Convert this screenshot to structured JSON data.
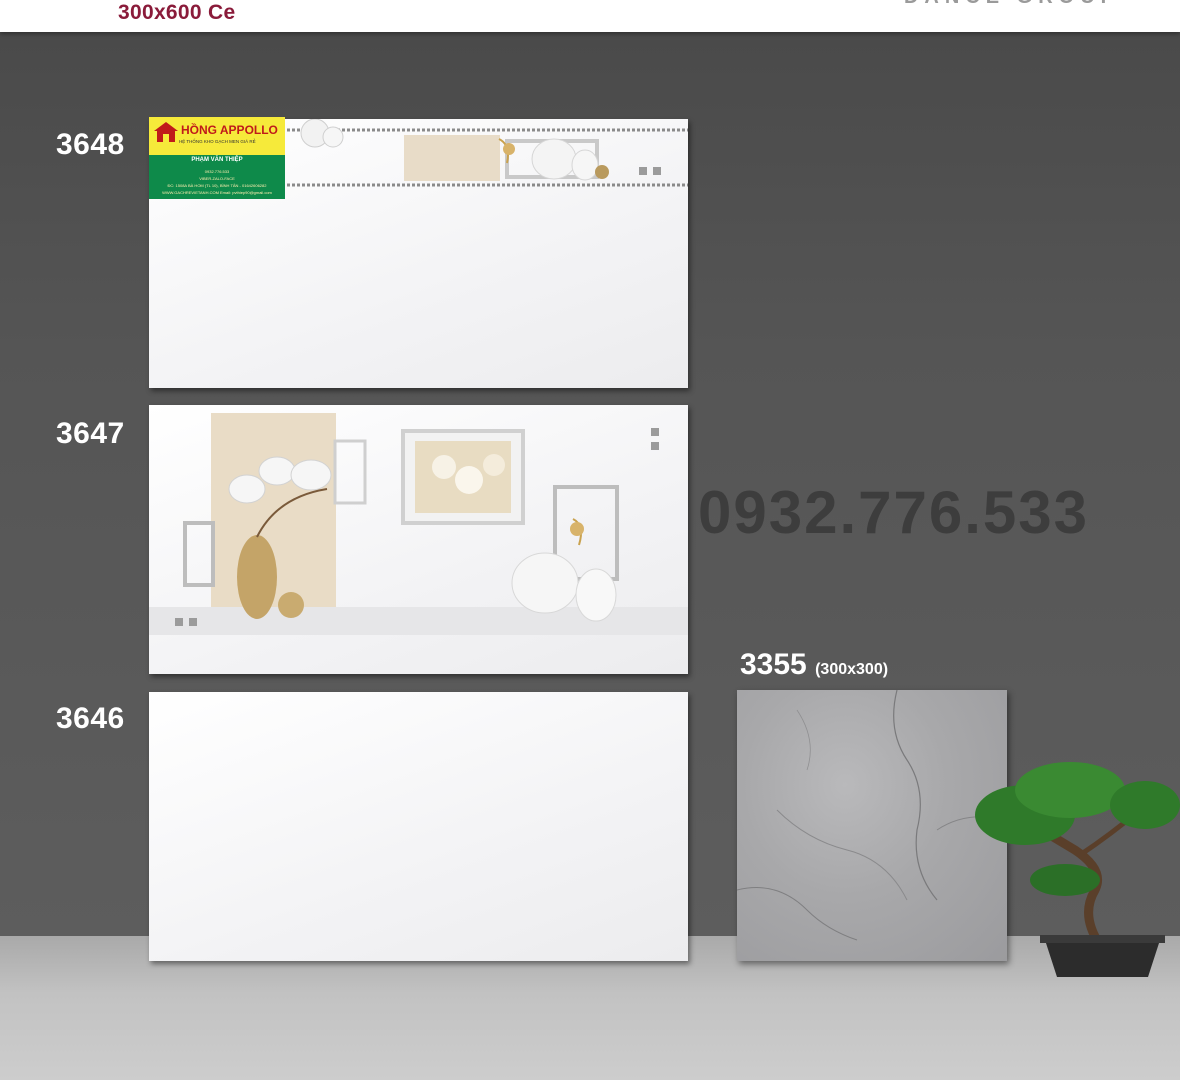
{
  "header": {
    "title": "300x600 Ce",
    "brand": "DANCE GROUP"
  },
  "tiles": [
    {
      "code": "3648"
    },
    {
      "code": "3647"
    },
    {
      "code": "3646"
    }
  ],
  "floor_tile": {
    "code": "3355",
    "size": "(300x300)"
  },
  "watermark_phone": "0932.776.533",
  "logo": {
    "name": "HỒNG APPOLLO",
    "tagline": "HỆ THỐNG KHO GẠCH MEN GIÁ RẺ",
    "person": "PHẠM VĂN THIỆP",
    "phone": "0932.776.533",
    "contact": "VIBER-ZALO-FACE",
    "address": "ĐC: 1508A BÀ HOM (TL 10), BÌNH TÂN - 01642606282",
    "web": "WWW.GACHREVIETANH.COM  Email: pvthiep90@gmail.com"
  },
  "colors": {
    "title": "#8a1b3a",
    "wall": "#555555",
    "floor": "#c2c2c2",
    "logo_yellow": "#f6ea3a",
    "logo_green": "#0e8a4a"
  }
}
